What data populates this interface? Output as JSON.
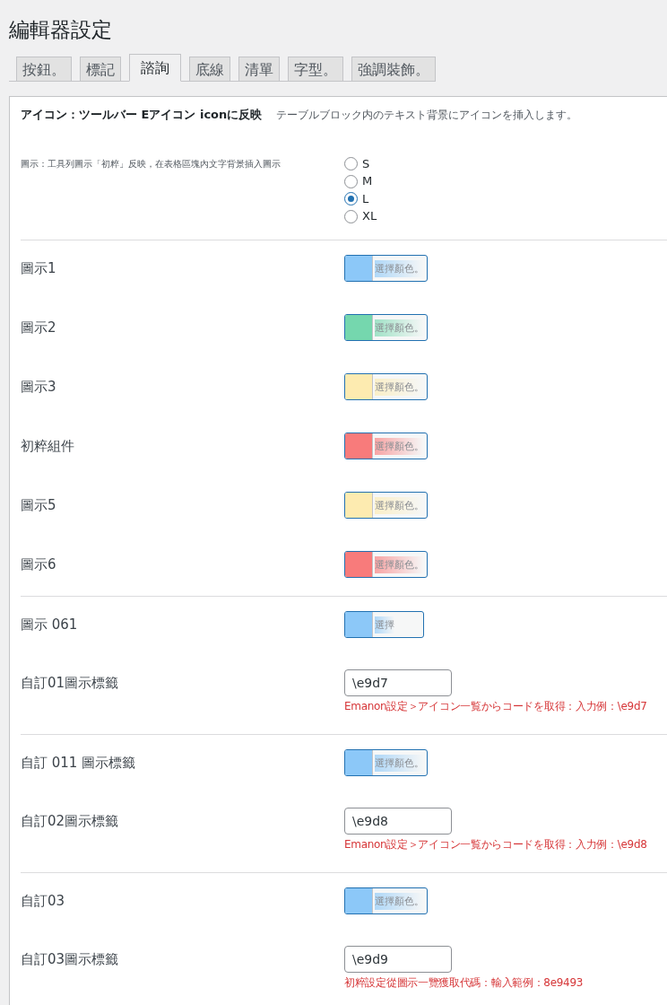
{
  "title": "編輯器設定",
  "tabs": [
    {
      "label": "按鈕。",
      "selected": false
    },
    {
      "label": "標記",
      "selected": false
    },
    {
      "label": "諮詢",
      "selected": true
    },
    {
      "label": "底線",
      "selected": false
    },
    {
      "label": "清單",
      "selected": false
    },
    {
      "label": "字型。",
      "selected": false
    },
    {
      "label": "強調裝飾。",
      "selected": false
    }
  ],
  "panel": {
    "heading": "アイコン：ツールバー Eアイコン iconに反映",
    "description": "テーブルブロック内のテキスト背景にアイコンを挿入します。",
    "sections": [
      {
        "rows": [
          {
            "kind": "radio",
            "label": "圖示：工具列圖示「初粹」反映，在表格區塊內文字背景插入圖示",
            "options": [
              {
                "label": "S",
                "selected": false
              },
              {
                "label": "M",
                "selected": false
              },
              {
                "label": "L",
                "selected": true
              },
              {
                "label": "XL",
                "selected": false
              }
            ]
          }
        ]
      },
      {
        "rows": [
          {
            "kind": "color",
            "label": "圖示1",
            "color": "#8cc8f8",
            "button": "選擇顏色。"
          },
          {
            "kind": "color",
            "label": "圖示2",
            "color": "#75d7ae",
            "button": "選擇顏色。"
          },
          {
            "kind": "color",
            "label": "圖示3",
            "color": "#fdebb0",
            "button": "選擇顏色。"
          },
          {
            "kind": "color",
            "label": "初粹組件",
            "color": "#f87b7b",
            "button": "選擇顏色。"
          },
          {
            "kind": "color",
            "label": "圖示5",
            "color": "#fdebb0",
            "button": "選擇顏色。"
          },
          {
            "kind": "color",
            "label": "圖示6",
            "color": "#f87b7b",
            "button": "選擇顏色。"
          }
        ]
      },
      {
        "rows": [
          {
            "kind": "color",
            "label": "圖示 061",
            "color": "#8cc8f8",
            "button": "選擇"
          },
          {
            "kind": "text",
            "label": "自訂01圖示標籤",
            "value": "\\e9d7",
            "hint": "Emanon設定＞アイコン一覧からコードを取得：入力例：\\e9d7"
          }
        ]
      },
      {
        "rows": [
          {
            "kind": "color",
            "label": "自訂 011 圖示標籤",
            "color": "#8cc8f8",
            "button": "選擇顏色。"
          },
          {
            "kind": "text",
            "label": "自訂02圖示標籤",
            "value": "\\e9d8",
            "hint": "Emanon設定＞アイコン一覧からコードを取得：入力例：\\e9d8"
          }
        ]
      },
      {
        "rows": [
          {
            "kind": "color",
            "label": "自訂03",
            "color": "#8cc8f8",
            "button": "選擇顏色。"
          },
          {
            "kind": "text",
            "label": "自訂03圖示標籤",
            "value": "\\e9d9",
            "hint": "初粹設定從圖示一覽獲取代碼：輸入範例：8e9493"
          }
        ]
      }
    ]
  }
}
